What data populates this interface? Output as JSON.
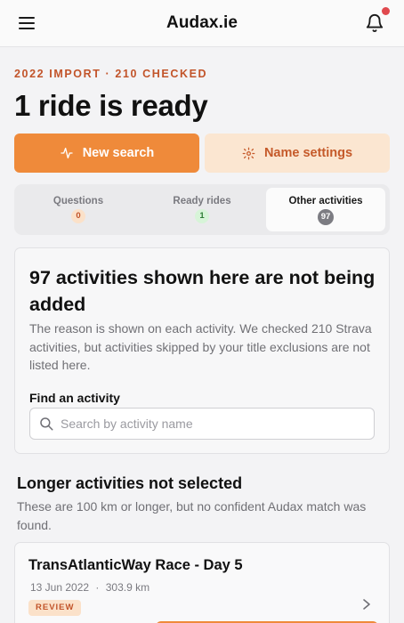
{
  "app": {
    "title": "Audax.ie"
  },
  "header": {
    "eyebrow": "2022 IMPORT · 210 CHECKED",
    "title": "1 ride is ready"
  },
  "actions": {
    "new_search": "New search",
    "name_settings": "Name settings"
  },
  "tabs": [
    {
      "label": "Questions",
      "count": "0"
    },
    {
      "label": "Ready rides",
      "count": "1"
    },
    {
      "label": "Other activities",
      "count": "97"
    }
  ],
  "notice": {
    "heading": "97 activities shown here are not being added",
    "text": "The reason is shown on each activity. We checked 210 Strava activities, but activities skipped by your title exclusions are not listed here.",
    "find_label": "Find an activity",
    "search_placeholder": "Search by activity name",
    "search_value": ""
  },
  "section": {
    "title": "Longer activities not selected",
    "description": "These are 100 km or longer, but no confident Audax match was found."
  },
  "activities": [
    {
      "title": "TransAtlanticWay Race - Day 5",
      "date": "13 Jun 2022",
      "separator": "·",
      "distance": "303.9 km",
      "badge": "REVIEW"
    }
  ],
  "icons": {
    "menu": "hamburger-icon",
    "bell": "bell-icon",
    "new_search": "activity-icon",
    "settings": "gear-icon",
    "search": "search-icon",
    "chevron": "chevron-right-icon"
  },
  "colors": {
    "accent": "#ef8a3a",
    "accent_text": "#c2542a",
    "accent_soft": "#fbe6d1",
    "notification": "#e0494e"
  }
}
